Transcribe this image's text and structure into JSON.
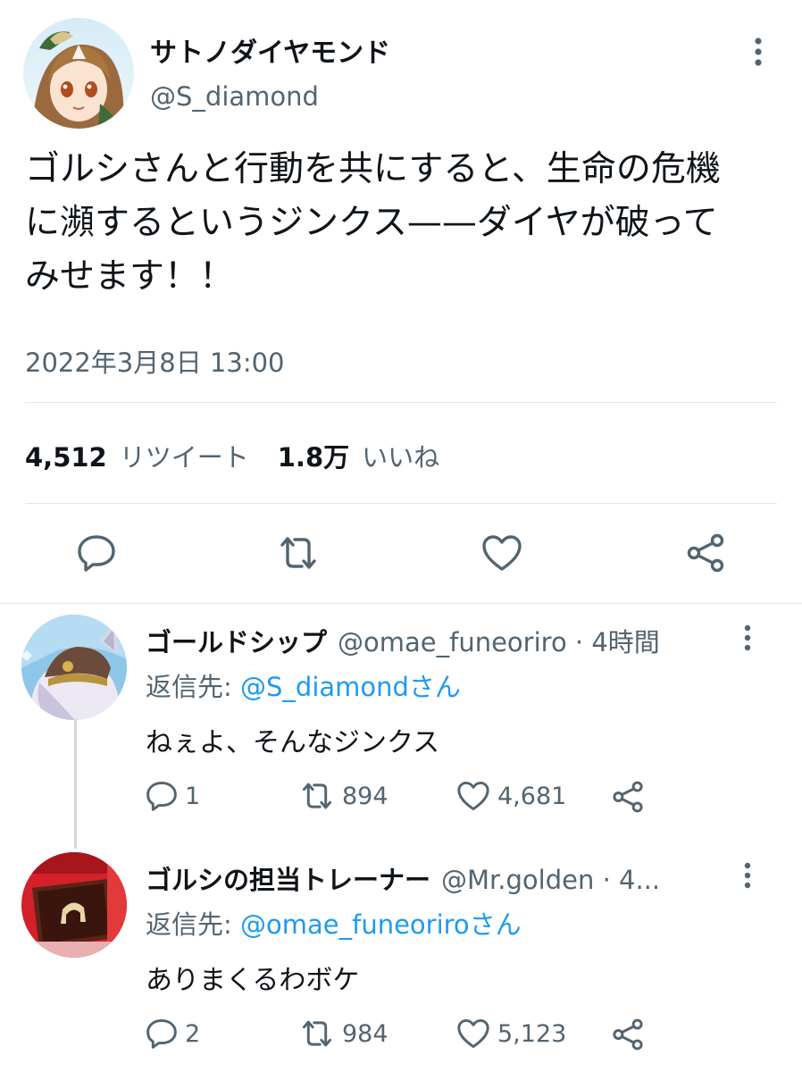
{
  "tweet": {
    "author_name": "サトノダイヤモンド",
    "author_handle": "@S_diamond",
    "text": "ゴルシさんと行動を共にすると、生命の危機に瀕するというジンクス——ダイヤが破ってみせます！！",
    "text_lines": [
      "ゴルシさんと行動を共にすると、生命の危機",
      "に瀕するというジンクス——ダイヤが破って",
      "みせます！！"
    ],
    "timestamp": "2022年3月8日 13:00",
    "retweets_count": "4,512",
    "retweets_label": "リツイート",
    "likes_count": "1.8万",
    "likes_label": "いいね"
  },
  "icons": {
    "more": "more-vertical-icon",
    "reply": "reply-bubble-icon",
    "retweet": "retweet-icon",
    "like": "heart-icon",
    "share": "share-icon"
  },
  "colors": {
    "text_primary": "#0f1419",
    "text_secondary": "#536471",
    "link": "#1d9bf0",
    "divider": "#e1e6ea"
  },
  "replies": [
    {
      "author_name": "ゴールドシップ",
      "meta": "@omae_funeoriro · 4時間",
      "reply_to_prefix": "返信先: ",
      "reply_to_mention": "@S_diamondさん",
      "text": "ねぇよ、そんなジンクス",
      "reply_count": "1",
      "retweet_count": "894",
      "like_count": "4,681"
    },
    {
      "author_name": "ゴルシの担当トレーナー",
      "meta": "@Mr.golden · 4...",
      "reply_to_prefix": "返信先: ",
      "reply_to_mention": "@omae_funeoriroさん",
      "text": "ありまくるわボケ",
      "reply_count": "2",
      "retweet_count": "984",
      "like_count": "5,123"
    }
  ]
}
